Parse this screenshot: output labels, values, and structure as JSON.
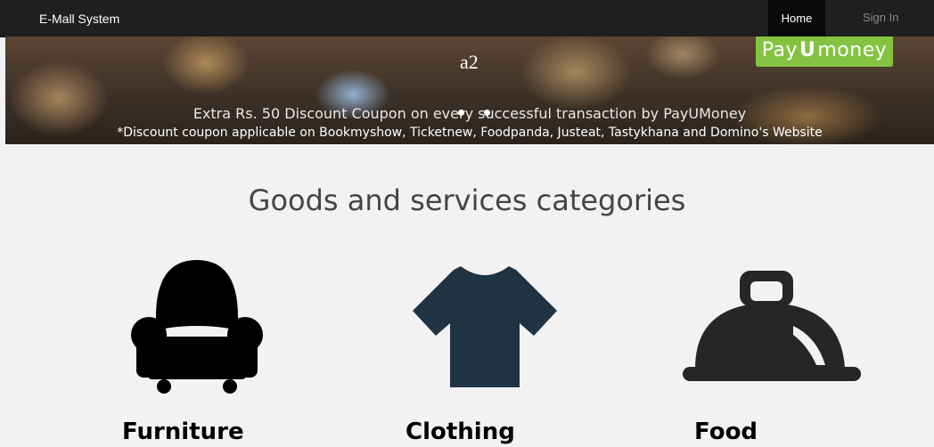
{
  "navbar": {
    "brand": "E-Mall System",
    "home_label": "Home",
    "signin_label": "Sign In"
  },
  "banner": {
    "caption_title": "a2",
    "promo_logo_text_left": "Pay",
    "promo_logo_text_mid": "U",
    "promo_logo_text_right": "money",
    "line1": "Extra Rs. 50 Discount Coupon on every successful transaction by PayUMoney",
    "line2": "*Discount coupon applicable on Bookmyshow, Ticketnew, Foodpanda, Justeat, Tastykhana and Domino's Website"
  },
  "section": {
    "title": "Goods and services categories"
  },
  "categories": [
    {
      "label": "Furniture",
      "icon": "armchair-icon"
    },
    {
      "label": "Clothing",
      "icon": "tshirt-icon"
    },
    {
      "label": "Food",
      "icon": "cloche-icon"
    }
  ],
  "colors": {
    "navbar_bg": "#1f1f1f",
    "tshirt": "#1f3343",
    "cloche": "#262626",
    "promo_green": "#83c341"
  }
}
